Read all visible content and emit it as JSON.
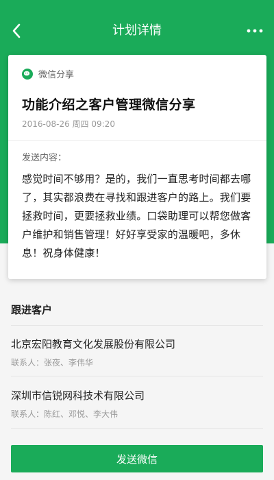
{
  "header": {
    "title": "计划详情",
    "back_icon": "chevron-left-icon",
    "more_icon": "more-dots-icon"
  },
  "plan": {
    "channel": "微信分享",
    "title": "功能介绍之客户管理微信分享",
    "datetime": "2016-08-26 周四 09:20",
    "content_label": "发送内容：",
    "content": "感觉时间不够用？是的，我们一直思考时间都去哪了，其实都浪费在寻找和跟进客户的路上。我们要拯救时间，更要拯救业绩。口袋助理可以帮您做客户维护和销售管理！好好享受家的温暖吧，多休息！祝身体健康！"
  },
  "clients": {
    "section_title": "跟进客户",
    "items": [
      {
        "name": "北京宏阳教育文化发展股份有限公司",
        "contacts": "联系人：张夜、李伟华"
      },
      {
        "name": "深圳市信锐网科技术有限公司",
        "contacts": "联系人：陈红、邓悦、李大伟"
      }
    ]
  },
  "actions": {
    "send_label": "发送微信"
  },
  "colors": {
    "brand_green": "#1aab59"
  }
}
